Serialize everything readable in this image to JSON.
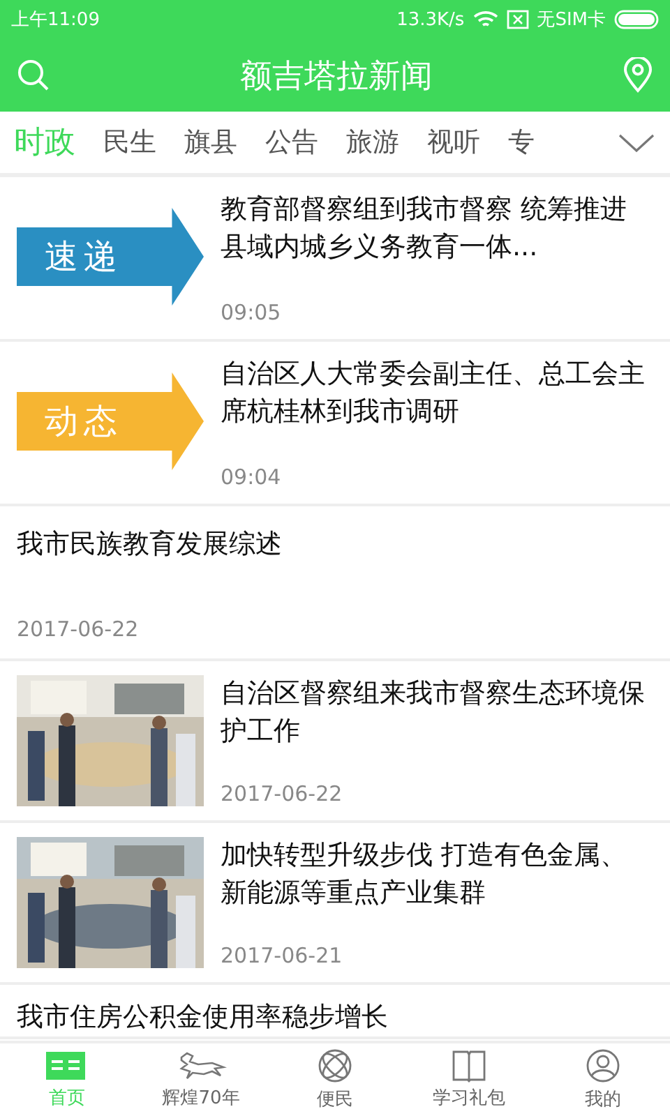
{
  "status_bar": {
    "time": "上午11:09",
    "speed": "13.3K/s",
    "sim": "无SIM卡"
  },
  "header": {
    "title": "额吉塔拉新闻"
  },
  "tabs": [
    {
      "label": "时政",
      "selected": true
    },
    {
      "label": "民生",
      "selected": false
    },
    {
      "label": "旗县",
      "selected": false
    },
    {
      "label": "公告",
      "selected": false
    },
    {
      "label": "旅游",
      "selected": false
    },
    {
      "label": "视听",
      "selected": false
    },
    {
      "label": "专",
      "selected": false
    }
  ],
  "news": [
    {
      "kind": "banner",
      "thumb_label": "速递",
      "color": "#2a8fc2",
      "title": "教育部督察组到我市督察 统筹推进县域内城乡义务教育一体...",
      "time": "09:05"
    },
    {
      "kind": "banner",
      "thumb_label": "动态",
      "color": "#f6b532",
      "title": "自治区人大常委会副主任、总工会主席杭桂林到我市调研",
      "time": "09:04"
    },
    {
      "kind": "text",
      "title": "我市民族教育发展综述",
      "time": "2017-06-22"
    },
    {
      "title": "自治区督察组来我市督察生态环境保护工作",
      "time": "2017-06-22"
    },
    {
      "title": "加快转型升级步伐 打造有色金属、新能源等重点产业集群",
      "time": "2017-06-21"
    },
    {
      "kind": "cut",
      "title": "我市住房公积金使用率稳步增长"
    }
  ],
  "bottom_nav": [
    {
      "label": "首页",
      "selected": true
    },
    {
      "label": "辉煌70年",
      "selected": false
    },
    {
      "label": "便民",
      "selected": false
    },
    {
      "label": "学习礼包",
      "selected": false
    },
    {
      "label": "我的",
      "selected": false
    }
  ]
}
